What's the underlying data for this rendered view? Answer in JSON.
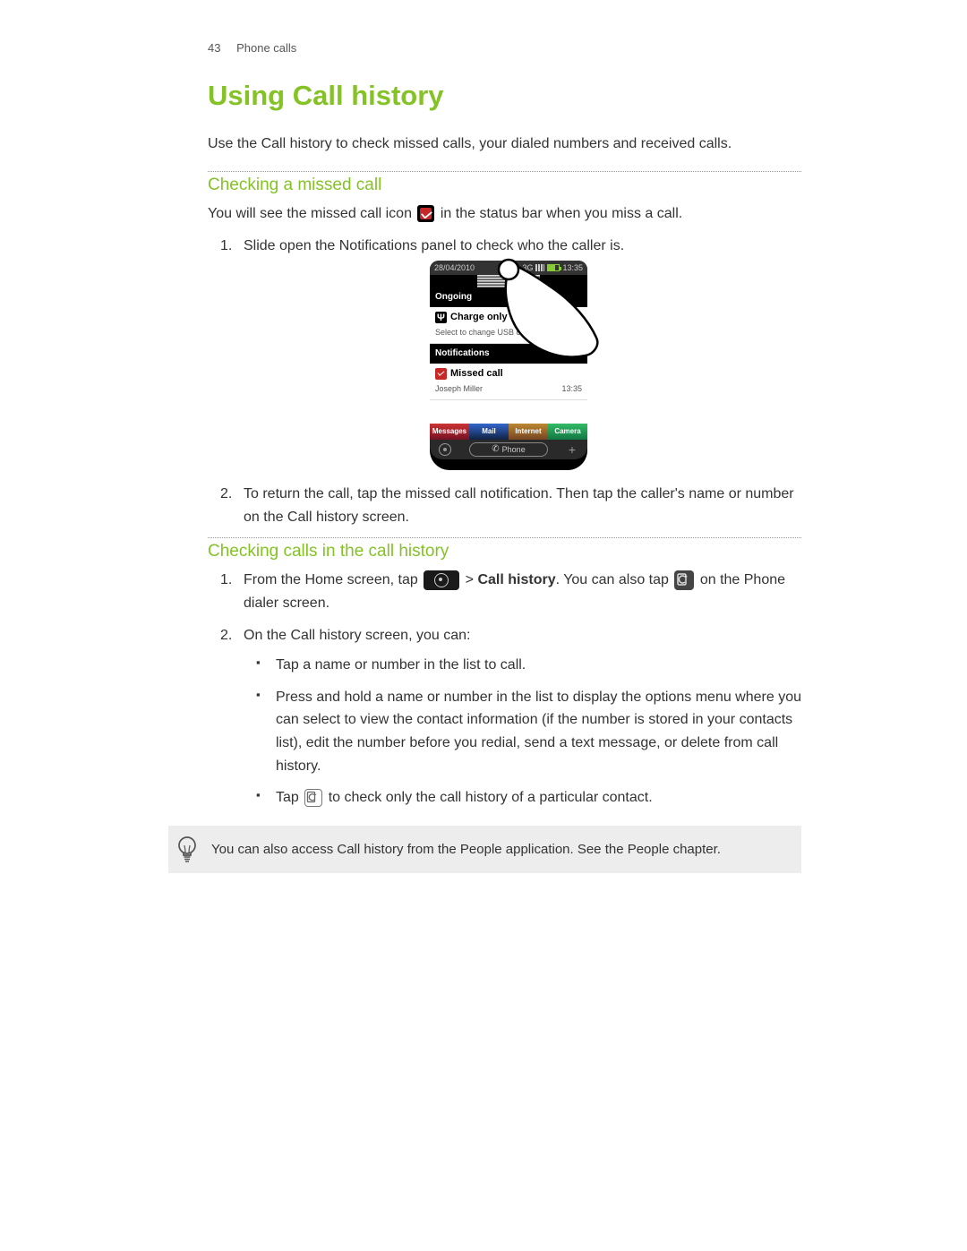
{
  "header": {
    "page_number": "43",
    "section": "Phone calls"
  },
  "title": "Using Call history",
  "intro": "Use the Call history to check missed calls, your dialed numbers and received calls.",
  "section1": {
    "heading": "Checking a missed call",
    "lead_a": "You will see the missed call icon",
    "lead_b": "in the status bar when you miss a call.",
    "step1": "Slide open the Notifications panel to check who the caller is.",
    "step2": "To return the call, tap the missed call notification. Then tap the caller's name or number on the Call history screen."
  },
  "phone": {
    "date": "28/04/2010",
    "net": "3G",
    "time": "13:35",
    "ongoing": "Ongoing",
    "charge": "Charge only",
    "charge_sub": "Select to change USB connection",
    "notifications": "Notifications",
    "missed": "Missed call",
    "caller": "Joseph Miller",
    "miss_time": "13:35",
    "tab1": "Messages",
    "tab2": "Mail",
    "tab3": "Internet",
    "tab4": "Camera",
    "phone_btn": "Phone"
  },
  "section2": {
    "heading": "Checking calls in the call history",
    "s1_a": "From the Home screen, tap",
    "s1_b": ">",
    "s1_bold": "Call history",
    "s1_c": ". You can also tap",
    "s1_d": "on the Phone dialer screen.",
    "s2": "On the Call history screen, you can:",
    "b1": "Tap a name or number in the list to call.",
    "b2": "Press and hold a name or number in the list to display the options menu where you can select to view the contact information (if the number is stored in your contacts list), edit the number before you redial, send a text message, or delete from call history.",
    "b3_a": "Tap",
    "b3_b": "to check only the call history of a particular contact."
  },
  "tip": "You can also access Call history from the People application. See the People chapter."
}
